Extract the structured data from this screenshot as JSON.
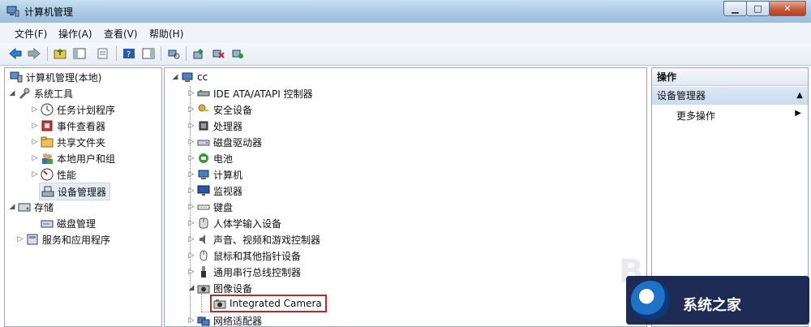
{
  "window": {
    "title": "计算机管理"
  },
  "menu": [
    "文件(F)",
    "操作(A)",
    "查看(V)",
    "帮助(H)"
  ],
  "tree_left": [
    {
      "label": "计算机管理(本地)",
      "icon": "computer-management-icon",
      "expand": "none"
    },
    {
      "label": "系统工具",
      "icon": "tools-icon",
      "expand": "open"
    },
    {
      "label": "任务计划程序",
      "icon": "clock-icon",
      "expand": "closed"
    },
    {
      "label": "事件查看器",
      "icon": "event-viewer-icon",
      "expand": "closed"
    },
    {
      "label": "共享文件夹",
      "icon": "shared-folder-icon",
      "expand": "closed"
    },
    {
      "label": "本地用户和组",
      "icon": "users-icon",
      "expand": "closed"
    },
    {
      "label": "性能",
      "icon": "performance-icon",
      "expand": "closed"
    },
    {
      "label": "设备管理器",
      "icon": "device-manager-icon",
      "expand": "none",
      "selected": true
    },
    {
      "label": "存储",
      "icon": "storage-icon",
      "expand": "open"
    },
    {
      "label": "磁盘管理",
      "icon": "disk-management-icon",
      "expand": "none"
    },
    {
      "label": "服务和应用程序",
      "icon": "services-icon",
      "expand": "closed"
    }
  ],
  "device_tree": {
    "root": "cc",
    "categories": [
      {
        "label": "IDE ATA/ATAPI 控制器",
        "icon": "ide-controller-icon",
        "expand": "closed"
      },
      {
        "label": "安全设备",
        "icon": "security-device-icon",
        "expand": "closed"
      },
      {
        "label": "处理器",
        "icon": "processor-icon",
        "expand": "closed"
      },
      {
        "label": "磁盘驱动器",
        "icon": "disk-drive-icon",
        "expand": "closed"
      },
      {
        "label": "电池",
        "icon": "battery-icon",
        "expand": "closed"
      },
      {
        "label": "计算机",
        "icon": "computer-icon",
        "expand": "closed"
      },
      {
        "label": "监视器",
        "icon": "monitor-icon",
        "expand": "closed"
      },
      {
        "label": "键盘",
        "icon": "keyboard-icon",
        "expand": "closed"
      },
      {
        "label": "人体学输入设备",
        "icon": "hid-icon",
        "expand": "closed"
      },
      {
        "label": "声音、视频和游戏控制器",
        "icon": "sound-icon",
        "expand": "closed"
      },
      {
        "label": "鼠标和其他指针设备",
        "icon": "mouse-icon",
        "expand": "closed"
      },
      {
        "label": "通用串行总线控制器",
        "icon": "usb-icon",
        "expand": "closed"
      },
      {
        "label": "图像设备",
        "icon": "imaging-device-icon",
        "expand": "open"
      },
      {
        "label": "Integrated Camera",
        "icon": "camera-icon",
        "child": true
      },
      {
        "label": "网络适配器",
        "icon": "network-adapter-icon",
        "expand": "closed"
      }
    ]
  },
  "actions": {
    "header": "操作",
    "section": "设备管理器",
    "more": "更多操作"
  },
  "watermark": {
    "text": "系统之家"
  },
  "colors": {
    "highlight_box": "#b52a2a",
    "titlebar": "#a9c9e3"
  }
}
